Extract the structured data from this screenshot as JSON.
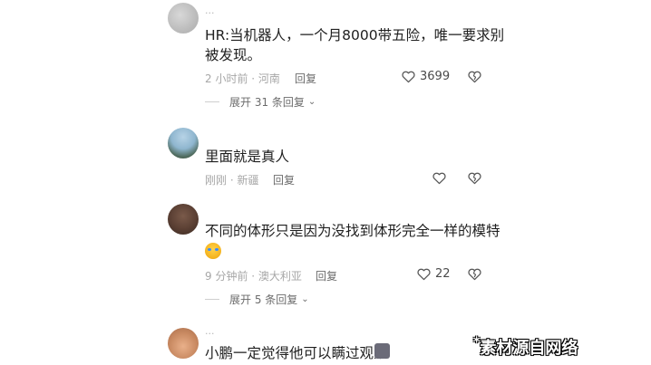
{
  "comments": [
    {
      "username": "···",
      "text_line1": "HR:当机器人，一个月8000带五险，唯一要求别",
      "text_line2": "被发现。",
      "meta": "2 小时前 · 河南",
      "reply_label": "回复",
      "likes": "3699",
      "expand_label": "展开 31 条回复"
    },
    {
      "text": "里面就是真人",
      "meta": "刚刚 · 新疆",
      "reply_label": "回复"
    },
    {
      "text": "不同的体形只是因为没找到体形完全一样的模特",
      "meta": "9 分钟前 · 澳大利亚",
      "reply_label": "回复",
      "likes": "22",
      "expand_label": "展开 5 条回复"
    },
    {
      "username": "···",
      "text": "小鹏一定觉得他可以瞒过观众"
    }
  ],
  "watermark": {
    "star": "*",
    "text": "素材源自网络"
  },
  "icons": {
    "like": "heart-outline-icon",
    "dislike": "broken-heart-icon",
    "expand": "chevron-down-icon",
    "emoji": "crying-laugh-emoji-icon"
  }
}
